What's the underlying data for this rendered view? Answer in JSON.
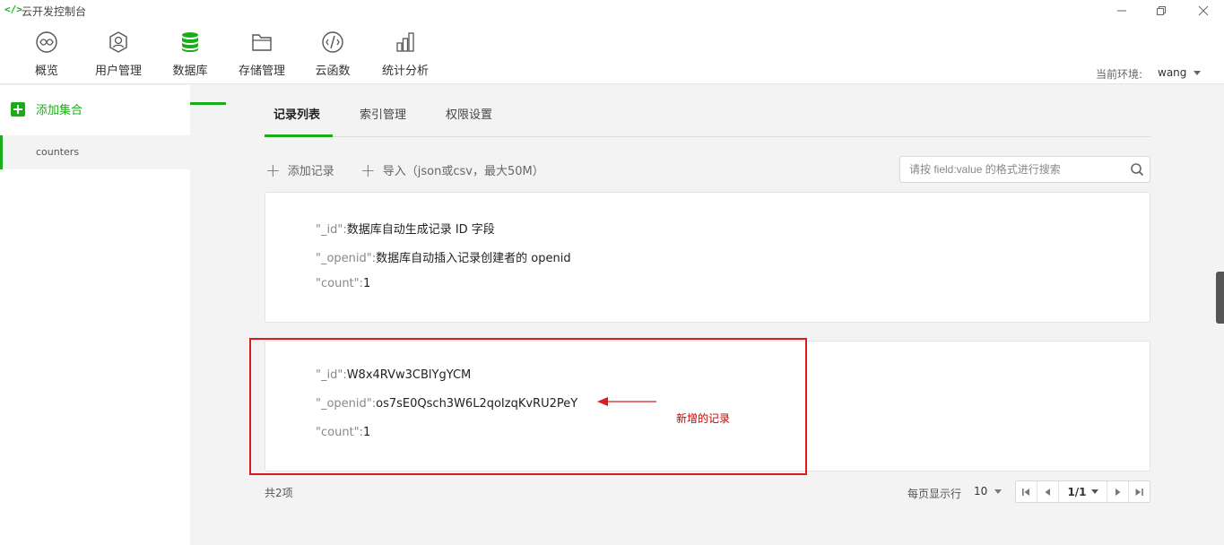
{
  "window": {
    "icon_glyph": "</>",
    "title": "云开发控制台"
  },
  "topnav": {
    "items": [
      {
        "label": "概览",
        "icon": "overview-icon"
      },
      {
        "label": "用户管理",
        "icon": "users-icon"
      },
      {
        "label": "数据库",
        "icon": "database-icon",
        "active": true
      },
      {
        "label": "存储管理",
        "icon": "folder-icon"
      },
      {
        "label": "云函数",
        "icon": "function-icon"
      },
      {
        "label": "统计分析",
        "icon": "stats-icon"
      }
    ],
    "env_label": "当前环境:",
    "env_value": "wang"
  },
  "sidebar": {
    "add_label": "添加集合",
    "collections": [
      "counters"
    ]
  },
  "tabs": [
    "记录列表",
    "索引管理",
    "权限设置"
  ],
  "actions": {
    "add_record": "添加记录",
    "import": "导入（json或csv，最大50M）",
    "search_placeholder": "请按 field:value 的格式进行搜索"
  },
  "records": [
    {
      "fields": [
        {
          "key": "\"_id\":",
          "value": "数据库自动生成记录 ID 字段"
        },
        {
          "key": "\"_openid\":",
          "value": "数据库自动插入记录创建者的 openid"
        },
        {
          "key": "\"count\":",
          "value": "1"
        }
      ]
    },
    {
      "fields": [
        {
          "key": "\"_id\":",
          "value": "W8x4RVw3CBlYgYCM"
        },
        {
          "key": "\"_openid\":",
          "value": "os7sE0Qsch3W6L2qoIzqKvRU2PeY"
        },
        {
          "key": "\"count\":",
          "value": "1"
        }
      ]
    }
  ],
  "annotation": "新增的记录",
  "footer": {
    "total": "共2项",
    "per_page_label": "每页显示行",
    "per_page_value": "10",
    "page": "1/1"
  },
  "colors": {
    "accent": "#1aad19",
    "annotation": "#d91c1c"
  }
}
